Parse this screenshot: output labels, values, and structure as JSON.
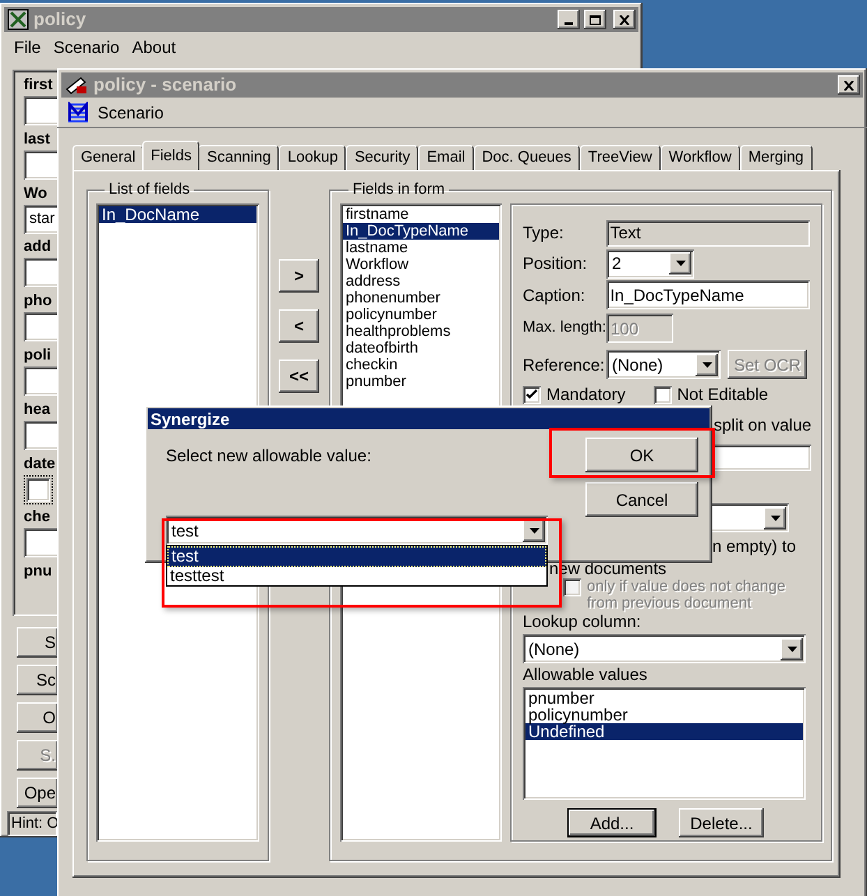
{
  "policy_window": {
    "title": "policy",
    "menu": [
      "File",
      "Scenario",
      "About"
    ],
    "form_fields": [
      {
        "label": "first",
        "kind": "text"
      },
      {
        "label": "last",
        "kind": "text"
      },
      {
        "label": "Wo",
        "kind": "text",
        "value": "star"
      },
      {
        "label": "add",
        "kind": "text"
      },
      {
        "label": "pho",
        "kind": "text"
      },
      {
        "label": "poli",
        "kind": "text"
      },
      {
        "label": "hea",
        "kind": "text"
      },
      {
        "label": "date",
        "kind": "checkbox",
        "checked": false
      },
      {
        "label": "che",
        "kind": "text"
      },
      {
        "label": "pnu",
        "kind": "label"
      }
    ],
    "buttons": [
      {
        "label": "S",
        "disabled": false
      },
      {
        "label": "Sc",
        "disabled": false
      },
      {
        "label": "O",
        "disabled": false
      },
      {
        "label": "S.",
        "disabled": true
      },
      {
        "label": "Ope",
        "disabled": false
      }
    ],
    "hint": "Hint: O"
  },
  "scenario_window": {
    "title": "policy - scenario",
    "toolbar_label": "Scenario",
    "tabs": [
      {
        "label": "General",
        "selected": false
      },
      {
        "label": "Fields",
        "selected": true
      },
      {
        "label": "Scanning",
        "selected": false
      },
      {
        "label": "Lookup",
        "selected": false
      },
      {
        "label": "Security",
        "selected": false
      },
      {
        "label": "Email",
        "selected": false
      },
      {
        "label": "Doc. Queues",
        "selected": false
      },
      {
        "label": "TreeView",
        "selected": false
      },
      {
        "label": "Workflow",
        "selected": false
      },
      {
        "label": "Merging",
        "selected": false
      }
    ],
    "list_of_fields": {
      "title": "List of fields",
      "items": [
        {
          "label": "In_DocName",
          "selected": true
        }
      ]
    },
    "move_buttons": [
      ">",
      "<",
      "<<"
    ],
    "fields_in_form": {
      "title": "Fields in form",
      "items": [
        {
          "label": "firstname",
          "selected": false
        },
        {
          "label": "In_DocTypeName",
          "selected": true
        },
        {
          "label": "lastname",
          "selected": false
        },
        {
          "label": "Workflow",
          "selected": false
        },
        {
          "label": "address",
          "selected": false
        },
        {
          "label": "phonenumber",
          "selected": false
        },
        {
          "label": "policynumber",
          "selected": false
        },
        {
          "label": "healthproblems",
          "selected": false
        },
        {
          "label": "dateofbirth",
          "selected": false
        },
        {
          "label": "checkin",
          "selected": false
        },
        {
          "label": "pnumber",
          "selected": false
        }
      ]
    },
    "properties": {
      "type": {
        "label": "Type:",
        "value": "Text"
      },
      "position": {
        "label": "Position:",
        "value": "2"
      },
      "caption": {
        "label": "Caption:",
        "value": "In_DocTypeName"
      },
      "max_length": {
        "label": "Max. length:",
        "value": "100",
        "disabled": true
      },
      "reference": {
        "label": "Reference:",
        "value": "(None)"
      },
      "set_ocr": {
        "label": "Set OCR",
        "disabled": true
      },
      "checkboxes": [
        {
          "label": "Mandatory",
          "checked": true
        },
        {
          "label": "Not Editable",
          "checked": false
        }
      ],
      "split_text": "split on value",
      "empty_text": "n empty) to",
      "new_docs_text": "new documents",
      "only_if": {
        "label": "only if value does not change from previous document",
        "checked": false,
        "disabled": true
      },
      "lookup": {
        "label": "Lookup column:",
        "value": "(None)"
      },
      "allowable": {
        "label": "Allowable values",
        "items": [
          {
            "label": "pnumber",
            "selected": false
          },
          {
            "label": "policynumber",
            "selected": false
          },
          {
            "label": "Undefined",
            "selected": true
          }
        ]
      },
      "buttons": [
        "Add...",
        "Delete..."
      ]
    }
  },
  "dialog": {
    "title": "Synergize",
    "prompt": "Select new allowable value:",
    "buttons": [
      "OK",
      "Cancel"
    ],
    "combo": {
      "value": "test",
      "options": [
        {
          "label": "test",
          "selected": true
        },
        {
          "label": "testtest",
          "selected": false
        }
      ]
    }
  }
}
